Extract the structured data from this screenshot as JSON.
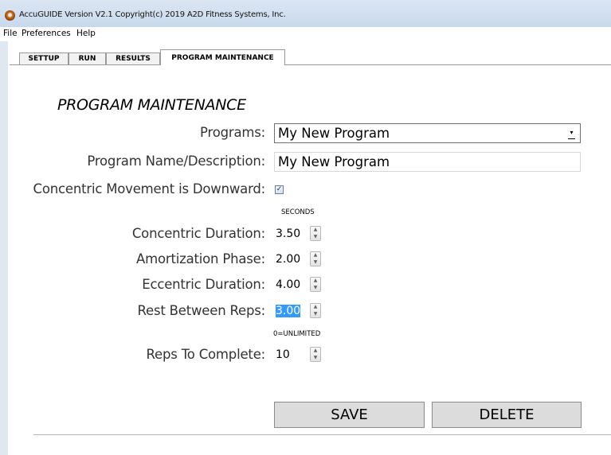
{
  "window": {
    "title": "AccuGUIDE Version V2.1 Copyright(c) 2019 A2D Fitness Systems, Inc.",
    "icon": "app-icon"
  },
  "menu": {
    "items": [
      "File",
      "Preferences",
      "Help"
    ]
  },
  "tabs": [
    {
      "label": "SETTUP",
      "active": false
    },
    {
      "label": "RUN",
      "active": false
    },
    {
      "label": "RESULTS",
      "active": false
    },
    {
      "label": "PROGRAM MAINTENANCE",
      "active": true
    }
  ],
  "form": {
    "section_title": "PROGRAM MAINTENANCE",
    "programs_label": "Programs:",
    "programs_value": "My New Program",
    "name_label": "Program Name/Description:",
    "name_value": "My New Program",
    "concentric_down_label": "Concentric Movement is Downward:",
    "concentric_down_checked": true,
    "seconds_caption": "SECONDS",
    "concentric_label": "Concentric Duration:",
    "concentric_value": "3.50",
    "amortization_label": "Amortization Phase:",
    "amortization_value": "2.00",
    "eccentric_label": "Eccentric Duration:",
    "eccentric_value": "4.00",
    "rest_label": "Rest Between Reps:",
    "rest_value": "3.00",
    "unlimited_caption": "0=UNLIMITED",
    "reps_label": "Reps To Complete:",
    "reps_value": "10"
  },
  "buttons": {
    "save": "SAVE",
    "delete": "DELETE"
  },
  "colors": {
    "selection": "#3399ff",
    "titlebar": "#c9d9ec"
  }
}
